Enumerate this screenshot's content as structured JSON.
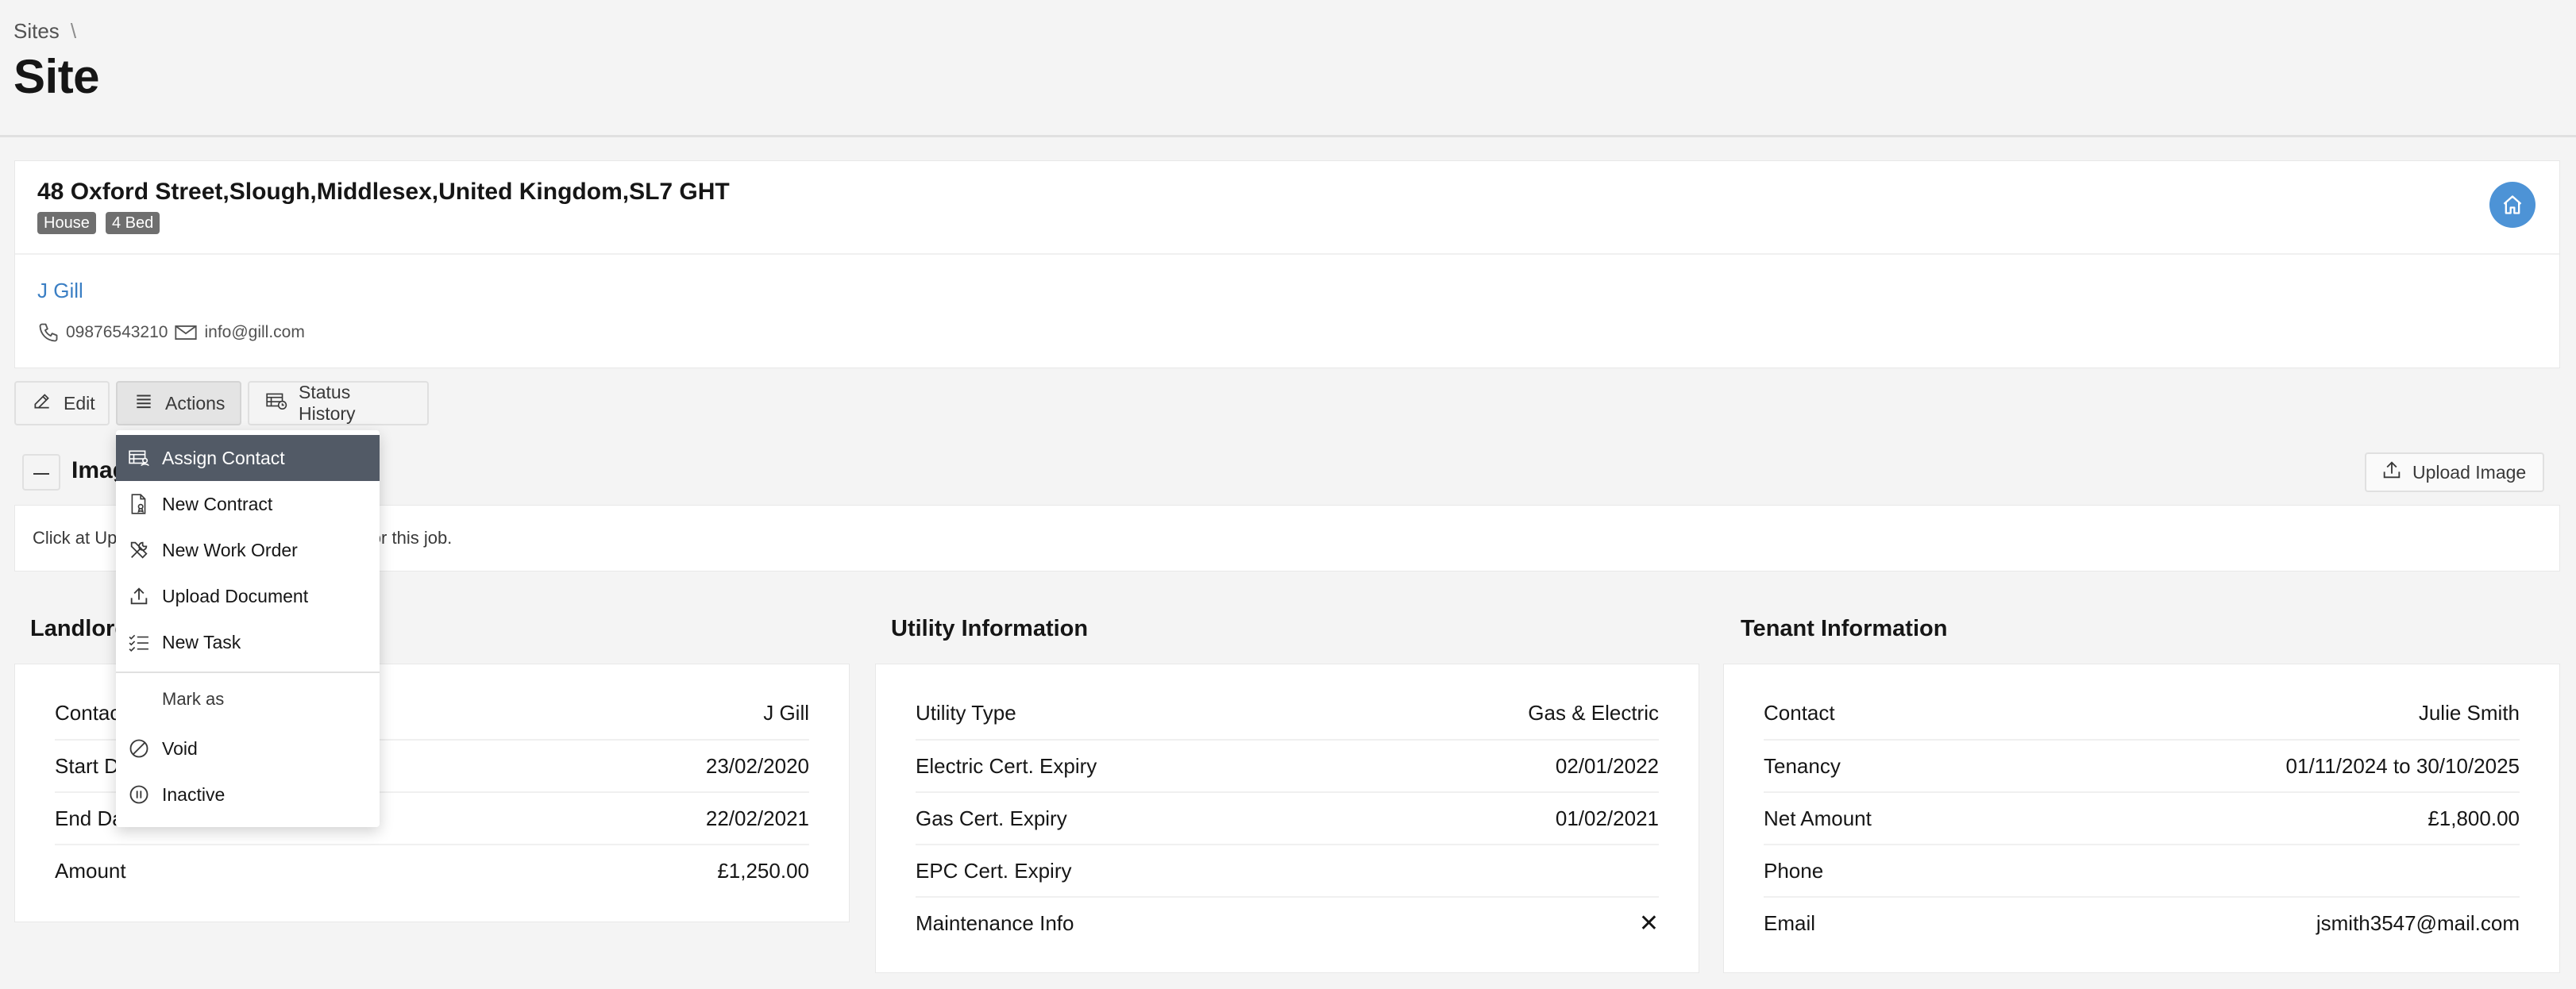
{
  "breadcrumb": {
    "root": "Sites",
    "separator": "\\"
  },
  "page_title": "Site",
  "site": {
    "address": "48 Oxford Street,Slough,Middlesex,United Kingdom,SL7 GHT",
    "tags": [
      "House",
      "4 Bed"
    ],
    "contact_name": "J Gill",
    "phone": "09876543210",
    "email": "info@gill.com"
  },
  "toolbar": {
    "edit_label": "Edit",
    "actions_label": "Actions",
    "status_history_label": "Status History"
  },
  "actions_menu": {
    "items": [
      {
        "label": "Assign Contact",
        "icon": "assign-contact-icon",
        "selected": true
      },
      {
        "label": "New Contract",
        "icon": "contract-icon"
      },
      {
        "label": "New Work Order",
        "icon": "tools-icon"
      },
      {
        "label": "Upload Document",
        "icon": "upload-icon"
      },
      {
        "label": "New Task",
        "icon": "task-list-icon"
      }
    ],
    "mark_as_label": "Mark as",
    "mark_items": [
      {
        "label": "Void",
        "icon": "void-icon"
      },
      {
        "label": "Inactive",
        "icon": "pause-icon"
      }
    ]
  },
  "images": {
    "title": "Images",
    "upload_label": "Upload Image",
    "hint": "Click at Upload Image to upload the image for this job."
  },
  "landlord": {
    "title": "Landlord Information",
    "rows": [
      {
        "label": "Contact",
        "value": "J Gill"
      },
      {
        "label": "Start Date",
        "value": "23/02/2020"
      },
      {
        "label": "End Date",
        "value": "22/02/2021"
      },
      {
        "label": "Amount",
        "value": "£1,250.00"
      }
    ]
  },
  "utility": {
    "title": "Utility Information",
    "rows": [
      {
        "label": "Utility Type",
        "value": "Gas & Electric"
      },
      {
        "label": "Electric Cert. Expiry",
        "value": "02/01/2022"
      },
      {
        "label": "Gas Cert. Expiry",
        "value": "01/02/2021"
      },
      {
        "label": "EPC Cert. Expiry",
        "value": ""
      },
      {
        "label": "Maintenance Info",
        "value": "✕"
      }
    ]
  },
  "tenant": {
    "title": "Tenant Information",
    "rows": [
      {
        "label": "Contact",
        "value": "Julie Smith"
      },
      {
        "label": "Tenancy",
        "value": "01/11/2024 to 30/10/2025"
      },
      {
        "label": "Net Amount",
        "value": "£1,800.00"
      },
      {
        "label": "Phone",
        "value": ""
      },
      {
        "label": "Email",
        "value": "jsmith3547@mail.com"
      }
    ]
  },
  "colors": {
    "accent": "#4d93d6",
    "link": "#3b7fc4",
    "menu_selected": "#525a66",
    "tag": "#6f6f6f"
  }
}
